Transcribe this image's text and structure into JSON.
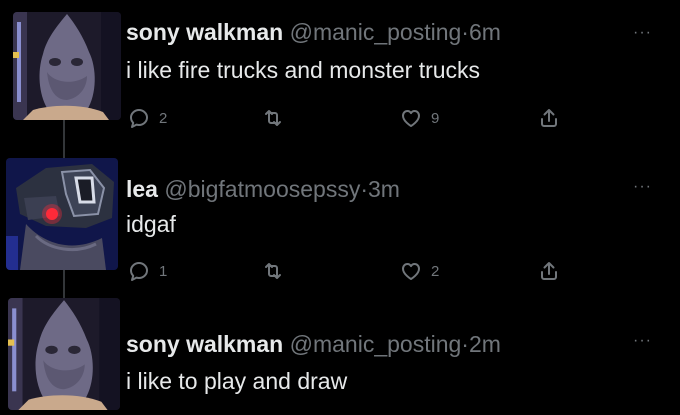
{
  "tweets": [
    {
      "name": "sony walkman",
      "handle": "@manic_posting",
      "separator": "·",
      "time": "6m",
      "text": "i like fire trucks and monster trucks",
      "replies": "2",
      "retweets": "",
      "likes": "9",
      "more": "···"
    },
    {
      "name": "lea",
      "handle": "@bigfatmoosepssy",
      "separator": "·",
      "time": "3m",
      "text": "idgaf",
      "replies": "1",
      "retweets": "",
      "likes": "2",
      "more": "···"
    },
    {
      "name": "sony walkman",
      "handle": "@manic_posting",
      "separator": "·",
      "time": "2m",
      "text": "i like to play and draw",
      "more": "···"
    }
  ],
  "icons": {
    "reply": "reply-icon",
    "retweet": "retweet-icon",
    "like": "heart-icon",
    "share": "share-icon"
  },
  "colors": {
    "background": "#000000",
    "text": "#e7e9ea",
    "muted": "#71767b",
    "thread_line": "#333639"
  }
}
